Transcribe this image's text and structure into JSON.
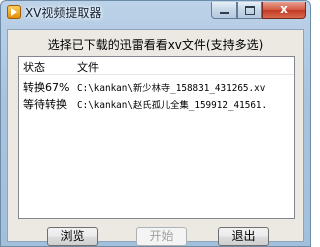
{
  "window": {
    "title": "XV视频提取器",
    "controls": {
      "minimize": "",
      "maximize": "",
      "close": "x"
    }
  },
  "prompt": "选择已下载的迅雷看看xv文件(支持多选)",
  "list": {
    "columns": [
      "状态",
      "文件"
    ],
    "rows": [
      {
        "status": "转换67%",
        "file": "C:\\kankan\\新少林寺_158831_431265.xv"
      },
      {
        "status": "等待转换",
        "file": "C:\\kankan\\赵氏孤儿全集_159912_41561."
      }
    ]
  },
  "buttons": {
    "browse": "浏览",
    "start": "开始",
    "exit": "退出"
  }
}
